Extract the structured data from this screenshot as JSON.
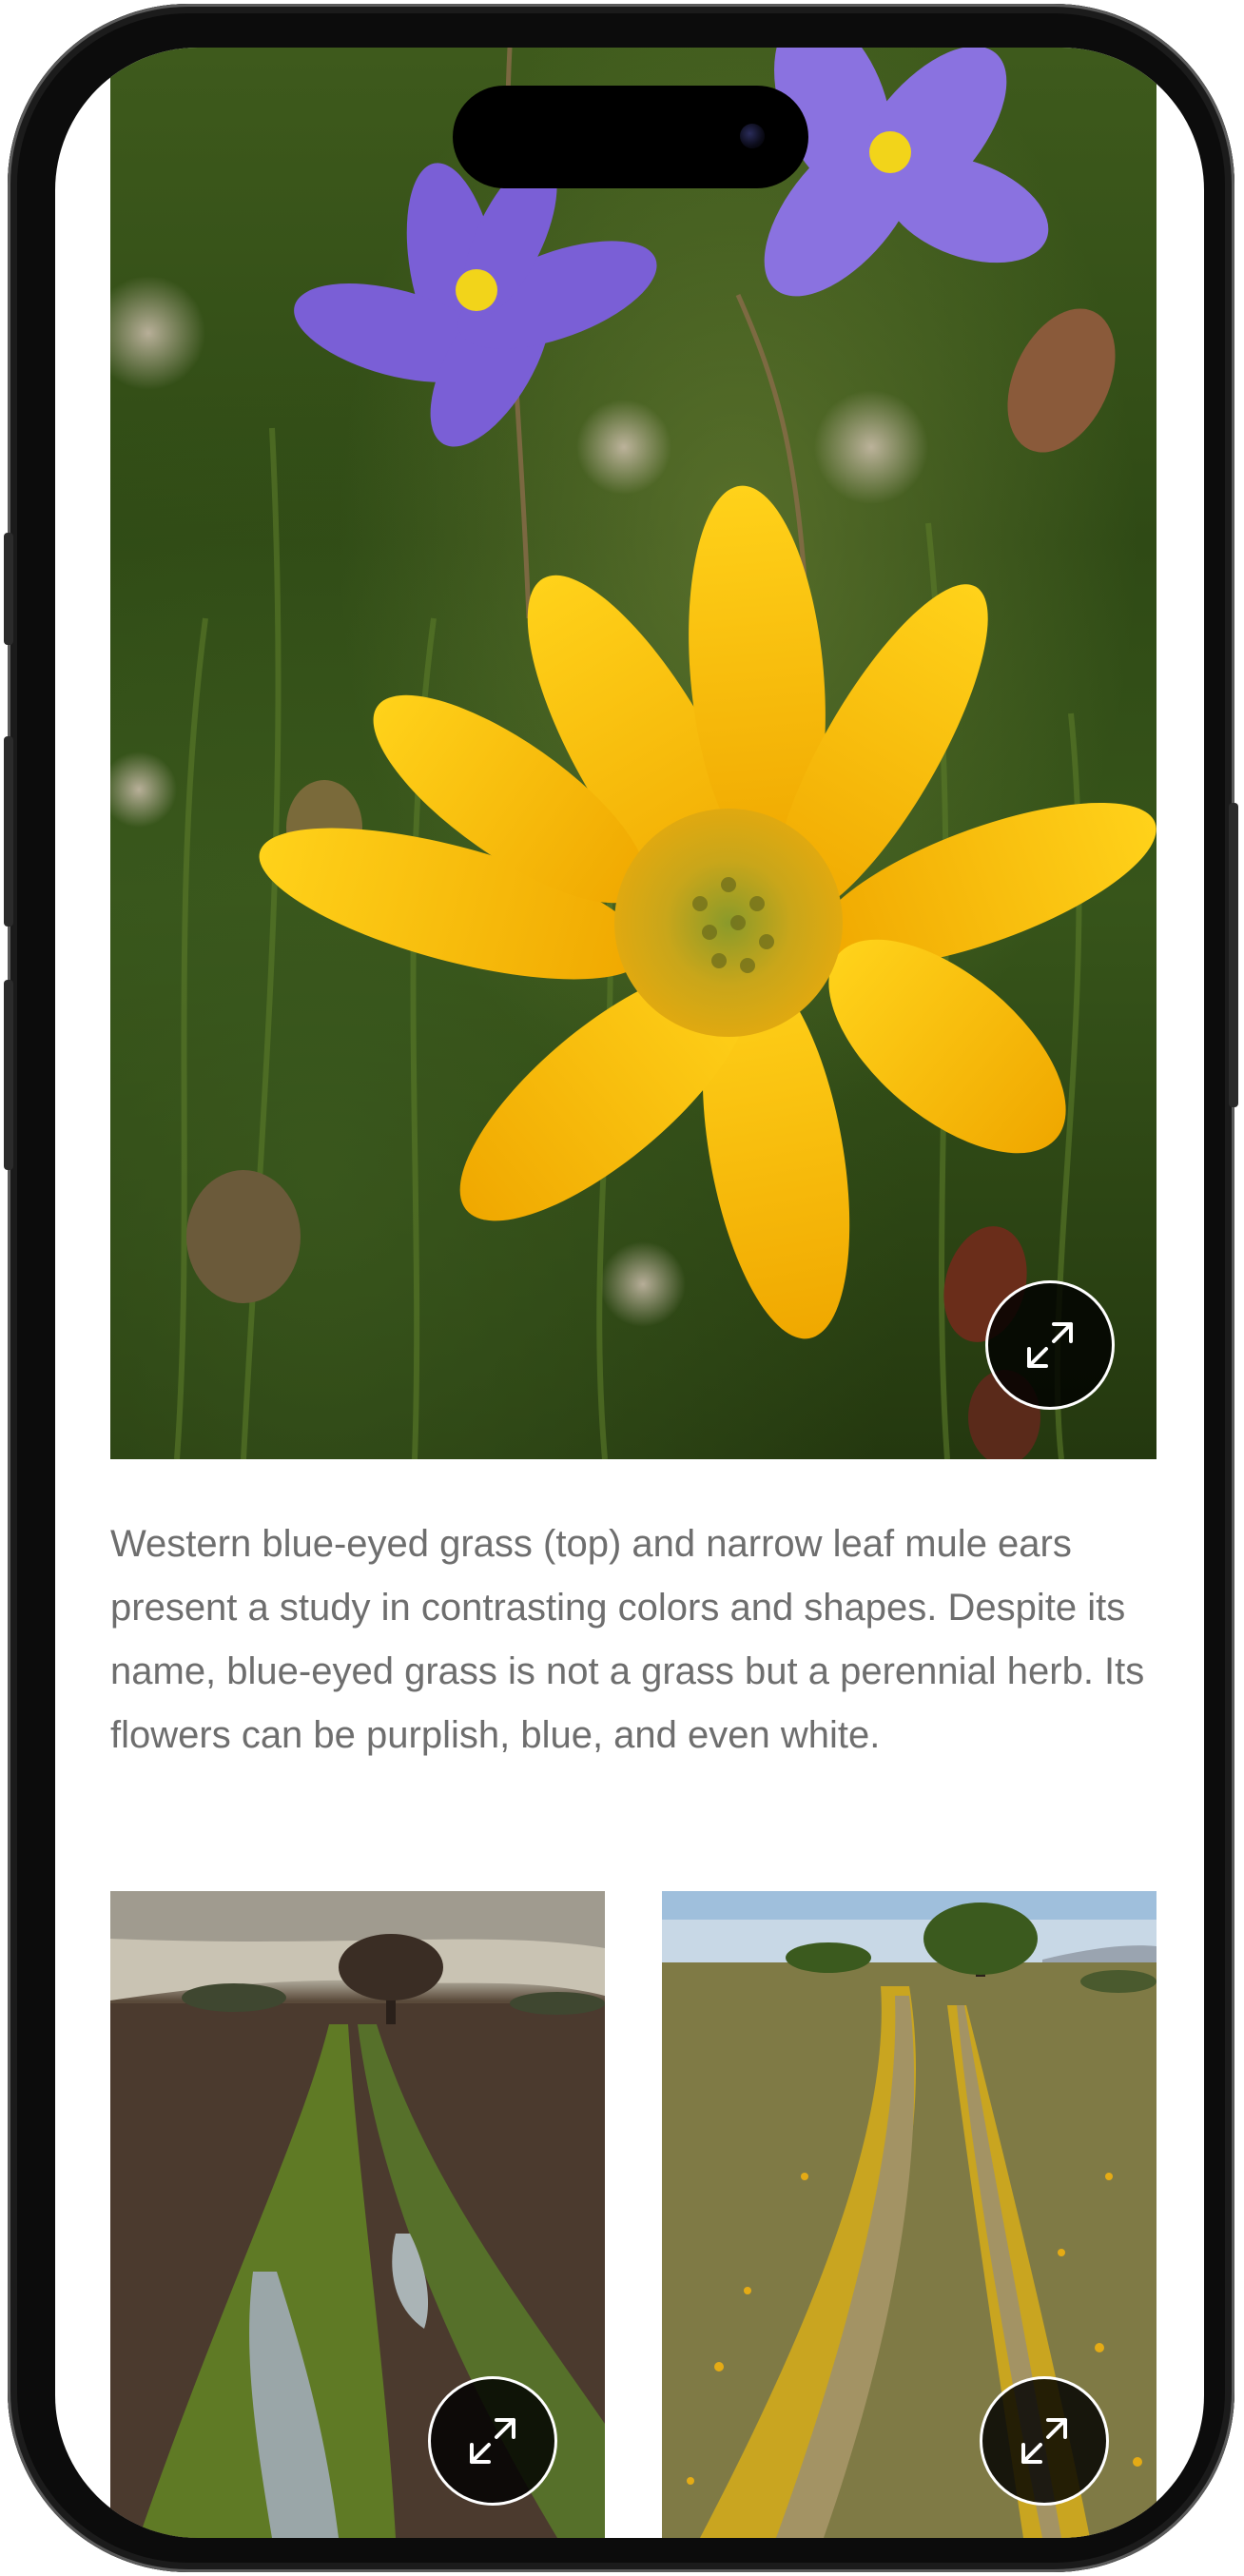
{
  "article": {
    "hero_image": {
      "alt": "Western blue-eyed grass and narrow leaf mule ears",
      "expand_icon": "expand-arrows-icon"
    },
    "caption": "Western blue-eyed grass (top) and narrow leaf mule ears present a study in contrasting colors and shapes. Despite its name, blue-eyed grass is not a grass but a perennial herb. Its flowers can be purplish, blue, and even white.",
    "gallery": [
      {
        "alt": "Muddy dirt road leading to an oak tree under cloudy sky",
        "expand_icon": "expand-arrows-icon"
      },
      {
        "alt": "Dirt road through a field of yellow wildflowers toward an oak tree",
        "expand_icon": "expand-arrows-icon"
      }
    ]
  },
  "colors": {
    "caption_text": "#6e6e6e",
    "button_bg": "#000000",
    "button_ring": "#ffffff",
    "mule_ears_yellow": "#f2b90d",
    "blue_eyed_grass": "#7a5fd6"
  }
}
